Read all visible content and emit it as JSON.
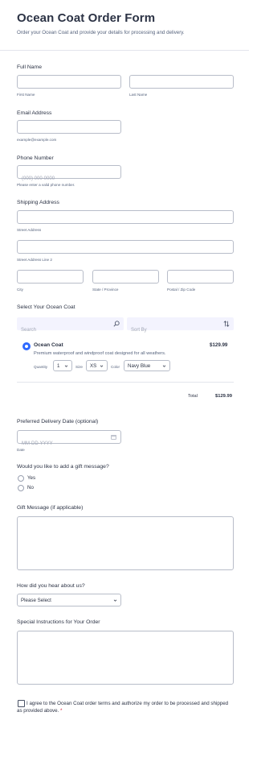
{
  "header": {
    "title": "Ocean Coat Order Form",
    "subtitle": "Order your Ocean Coat and provide your details for processing and delivery."
  },
  "full_name": {
    "label": "Full Name",
    "first_sub": "First Name",
    "last_sub": "Last Name",
    "first_value": "",
    "last_value": ""
  },
  "email": {
    "label": "Email Address",
    "value": "",
    "sub": "example@example.com"
  },
  "phone": {
    "label": "Phone Number",
    "placeholder": "(000) 000-0000",
    "sub": "Please enter a valid phone number."
  },
  "shipping": {
    "label": "Shipping Address",
    "street_sub": "Street Address",
    "street2_sub": "Street Address Line 2",
    "city_sub": "City",
    "state_sub": "State / Province",
    "zip_sub": "Postal / Zip Code"
  },
  "product": {
    "label": "Select Your Ocean Coat",
    "search_placeholder": "Search",
    "sort_placeholder": "Sort By",
    "name": "Ocean Coat",
    "description": "Premium waterproof and windproof coat designed for all weathers.",
    "price": "$129.99",
    "quantity_label": "Quantity",
    "quantity_value": "1",
    "size_label": "Size",
    "size_value": "XS",
    "color_label": "Color",
    "color_value": "Navy Blue",
    "selected": true,
    "total_label": "Total",
    "total_value": "$129.99"
  },
  "delivery": {
    "label": "Preferred Delivery Date (optional)",
    "placeholder": "MM-DD-YYYY",
    "sub": "Date"
  },
  "gift": {
    "question": "Would you like to add a gift message?",
    "options": [
      "Yes",
      "No"
    ],
    "message_label": "Gift Message (if applicable)"
  },
  "referral": {
    "label": "How did you hear about us?",
    "selected": "Please Select"
  },
  "instructions": {
    "label": "Special Instructions for Your Order"
  },
  "agreement": {
    "text": "I agree to the Ocean Coat order terms and authorize my order to be processed and shipped as provided above.",
    "required_mark": "*"
  },
  "colors": {
    "accent": "#2e69ff",
    "text": "#2c3345",
    "border": "#b8bdc9",
    "required": "#d1283c"
  }
}
